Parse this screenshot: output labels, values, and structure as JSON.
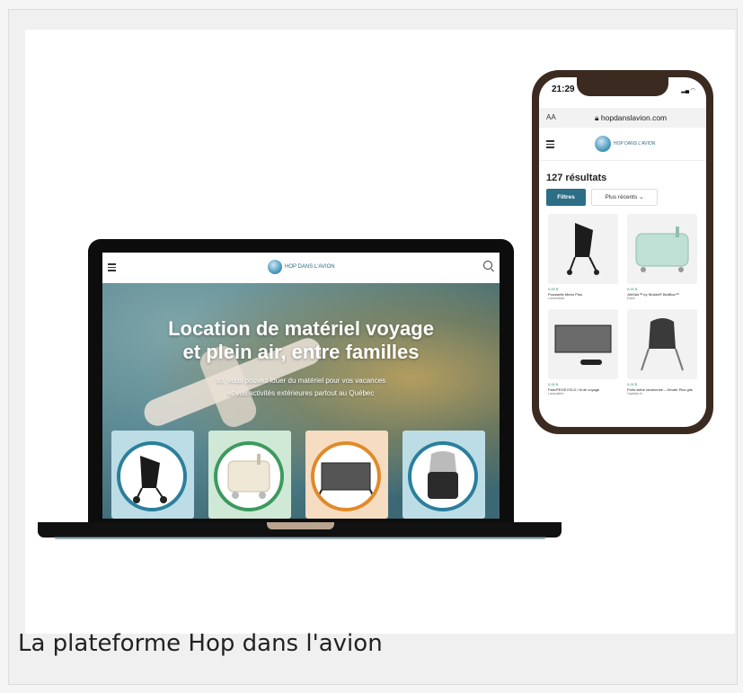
{
  "caption": "La plateforme Hop dans l'avion",
  "colors": {
    "brand": "#2b6e86",
    "price": "#2b8c6a",
    "phone_frame": "#3a2a20"
  },
  "laptop": {
    "logo_text": "HOP DANS L'AVION",
    "hero_title_line1": "Location de matériel voyage",
    "hero_title_line2": "et plein air, entre familles",
    "hero_sub_line1": "Ici, vous pouvez louer du matériel pour vos vacances",
    "hero_sub_line2": "et vos activités extérieures partout au Québec",
    "categories": [
      {
        "icon": "stroller-icon",
        "bg": "#bcdde6",
        "ring": "#2b7f9c"
      },
      {
        "icon": "ride-on-suitcase-icon",
        "bg": "#cfe9d6",
        "ring": "#3c9a5e"
      },
      {
        "icon": "travel-crib-icon",
        "bg": "#f6dcc0",
        "ring": "#e08a2a"
      },
      {
        "icon": "car-seat-icon",
        "bg": "#bcdde6",
        "ring": "#2b7f9c"
      }
    ]
  },
  "phone": {
    "time": "21:29",
    "aa": "AA",
    "url": "hopdanslavion.com",
    "logo_text": "HOP DANS L'AVION",
    "results": "127 résultats",
    "filter_label": "Filtres",
    "sort_label": "Plus récents",
    "products": [
      {
        "icon": "stroller-icon",
        "price": "0,00 $",
        "name": "Poussette Metro Plus",
        "loc": "Laurentides"
      },
      {
        "icon": "ride-on-suitcase-icon",
        "price": "0,00 $",
        "name": "JetKids™ by Stokke® BedBox™",
        "loc": "Estrie"
      },
      {
        "icon": "travel-crib-icon",
        "price": "0,00 $",
        "name": "Parc/PEGEYOLD / lit de voyage",
        "loc": "Lanaudière"
      },
      {
        "icon": "baby-carrier-icon",
        "price": "0,00 $",
        "name": "Porte-bébé randonnée – Deuter Plus gris",
        "loc": "Capitale-N"
      }
    ]
  }
}
